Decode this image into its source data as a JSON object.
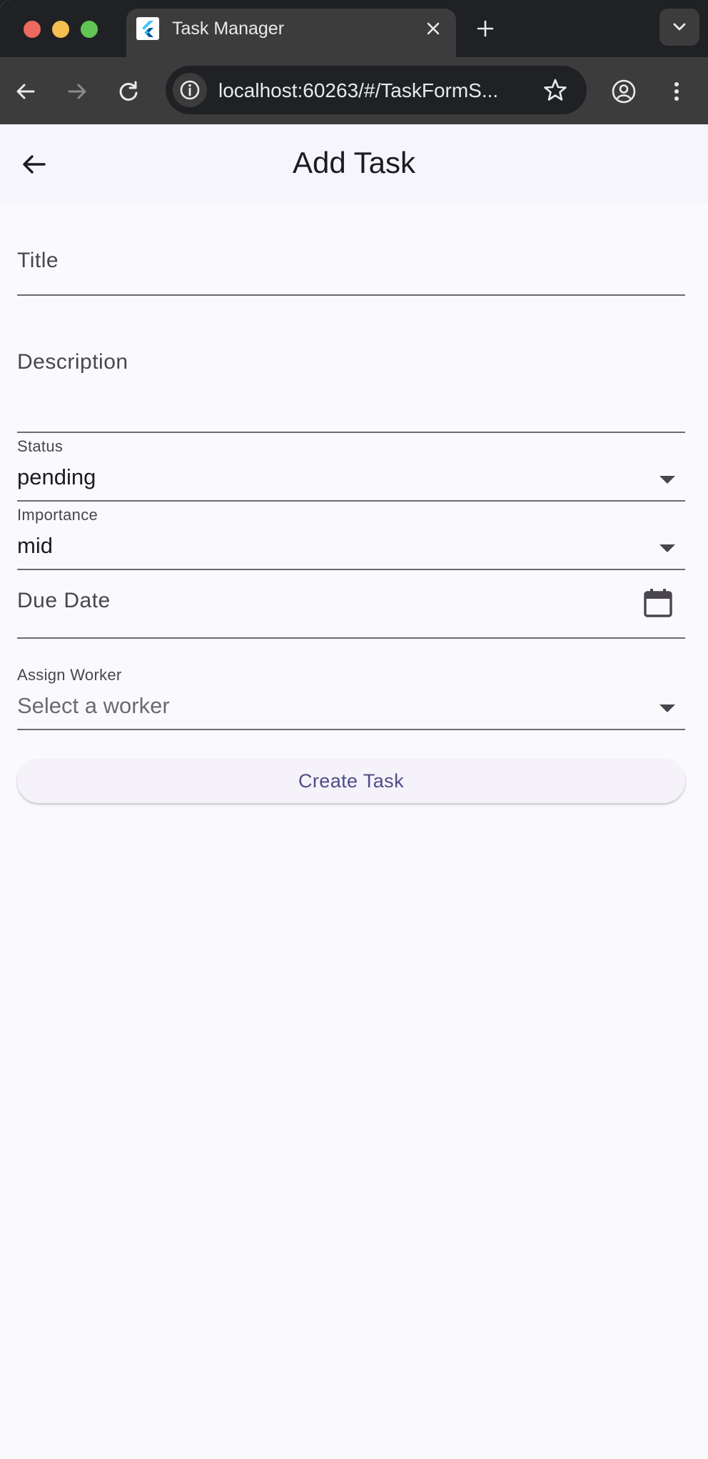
{
  "browser": {
    "tab_title": "Task Manager",
    "url": "localhost:60263/#/TaskFormS...",
    "icons": [
      "close-icon",
      "plus-icon",
      "chevron-down-icon",
      "arrow-left-icon",
      "arrow-right-icon",
      "reload-icon",
      "info-icon",
      "star-icon",
      "account-icon",
      "more-vert-icon"
    ]
  },
  "appbar": {
    "title": "Add Task"
  },
  "form": {
    "title": {
      "label": "Title",
      "value": ""
    },
    "description": {
      "label": "Description",
      "value": ""
    },
    "status": {
      "label": "Status",
      "value": "pending"
    },
    "importance": {
      "label": "Importance",
      "value": "mid"
    },
    "due_date": {
      "label": "Due Date",
      "value": ""
    },
    "worker": {
      "label": "Assign Worker",
      "placeholder": "Select a worker"
    },
    "submit_label": "Create Task"
  },
  "colors": {
    "accent_text": "#4f4d86",
    "appbar_bg": "#f7f5fc",
    "page_bg": "#fafafc"
  }
}
